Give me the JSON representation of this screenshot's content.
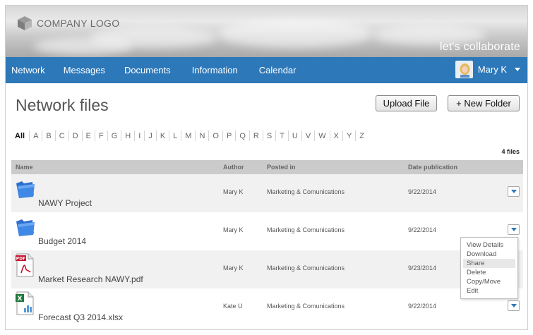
{
  "header": {
    "logo_text": "COMPANY LOGO",
    "tagline": "let's collaborate"
  },
  "nav": {
    "items": [
      {
        "label": "Network"
      },
      {
        "label": "Messages"
      },
      {
        "label": "Documents"
      },
      {
        "label": "Information"
      },
      {
        "label": "Calendar"
      }
    ],
    "user_name": "Mary K"
  },
  "page": {
    "title": "Network files",
    "upload_label": "Upload File",
    "new_folder_label": "+ New Folder",
    "file_count": "4 files"
  },
  "alphabet": [
    "All",
    "A",
    "B",
    "C",
    "D",
    "E",
    "F",
    "G",
    "H",
    "I",
    "J",
    "K",
    "L",
    "M",
    "N",
    "O",
    "P",
    "Q",
    "R",
    "S",
    "T",
    "U",
    "V",
    "W",
    "X",
    "Y",
    "Z"
  ],
  "table": {
    "headers": {
      "name": "Name",
      "author": "Author",
      "posted_in": "Posted in",
      "date": "Date publication"
    },
    "rows": [
      {
        "name": "NAWY Project",
        "author": "Mary K",
        "posted_in": "Marketing & Comunications",
        "date": "9/22/2014",
        "icon": "folder-icon"
      },
      {
        "name": "Budget 2014",
        "author": "Mary K",
        "posted_in": "Marketing & Comunications",
        "date": "9/22/2014",
        "icon": "folder-icon"
      },
      {
        "name": "Market Research NAWY.pdf",
        "author": "Mary K",
        "posted_in": "Marketing & Comunications",
        "date": "9/23/2014",
        "icon": "pdf-file-icon"
      },
      {
        "name": "Forecast Q3 2014.xlsx",
        "author": "Kate U",
        "posted_in": "Marketing & Comunications",
        "date": "9/22/2014",
        "icon": "excel-file-icon"
      }
    ]
  },
  "context_menu": {
    "items": [
      "View Details",
      "Download",
      "Share",
      "Delete",
      "Copy/Move",
      "Edit"
    ],
    "active": "Share"
  },
  "colors": {
    "accent": "#2d78b9",
    "header_row": "#cbcbcb",
    "alt_row": "#f1f1f1"
  }
}
